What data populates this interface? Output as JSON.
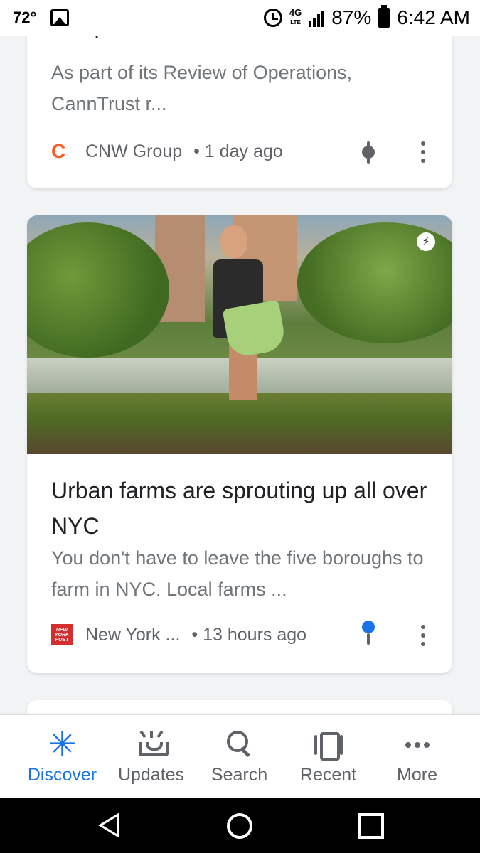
{
  "status_bar": {
    "temperature": "72°",
    "network": "4G",
    "network_sub": "LTE",
    "battery": "87%",
    "time": "6:42 AM"
  },
  "feed": [
    {
      "title_cut": "compliance and ...",
      "snippet": "As part of its Review of Operations, CannTrust r...",
      "source_logo": "C",
      "source": "CNW Group",
      "time": "• 1 day ago"
    },
    {
      "badge": "⚡",
      "title": "Urban farms are sprouting up all over NYC",
      "snippet": "You don't have to leave the five boroughs to farm in NYC. Local farms ...",
      "source_logo": "NEW YORK POST",
      "source": "New York ...",
      "time": "• 13 hours ago"
    }
  ],
  "bottom_nav": [
    {
      "label": "Discover",
      "icon": "discover-asterisk-icon",
      "active": true
    },
    {
      "label": "Updates",
      "icon": "updates-tray-icon",
      "active": false
    },
    {
      "label": "Search",
      "icon": "search-icon",
      "active": false
    },
    {
      "label": "Recent",
      "icon": "recent-cards-icon",
      "active": false
    },
    {
      "label": "More",
      "icon": "more-dots-icon",
      "active": false
    }
  ],
  "colors": {
    "accent": "#1a73e8",
    "source_c": "#ff5722",
    "nyp_red": "#d32f2f",
    "text_secondary": "#70757a"
  }
}
